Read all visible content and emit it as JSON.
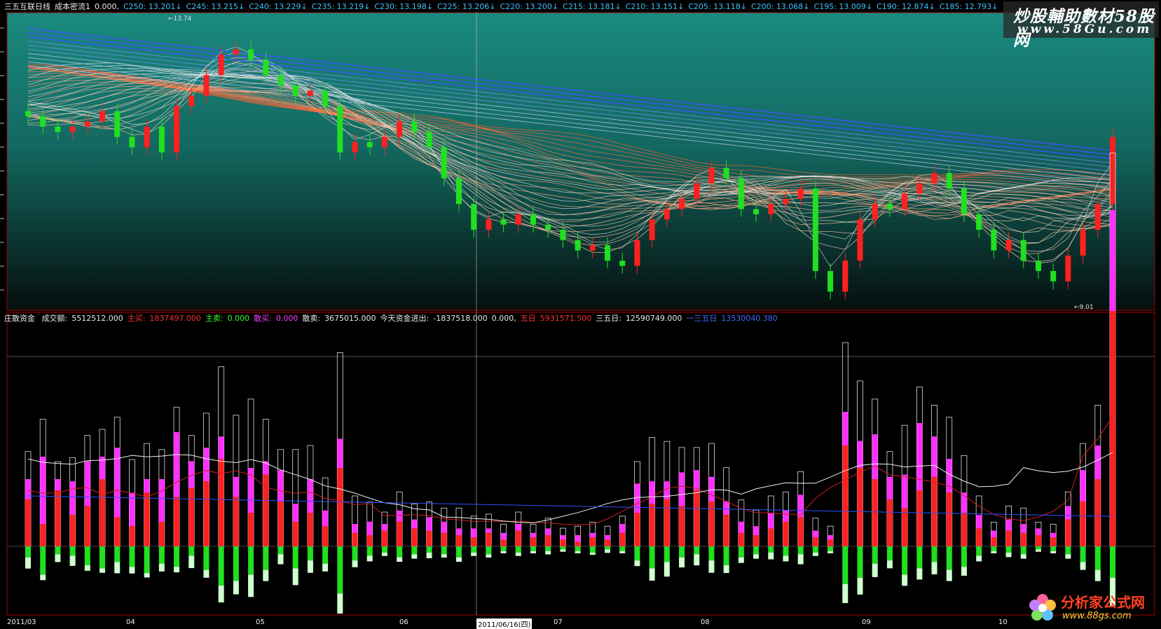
{
  "top_header": {
    "indicator": "三五互联日线",
    "cost_label": "成本密流1",
    "cost_value": "0.000,",
    "c_values": [
      {
        "label": "C250:",
        "value": "13.201"
      },
      {
        "label": "C245:",
        "value": "13.215"
      },
      {
        "label": "C240:",
        "value": "13.229"
      },
      {
        "label": "C235:",
        "value": "13.219"
      },
      {
        "label": "C230:",
        "value": "13.198"
      },
      {
        "label": "C225:",
        "value": "13.206"
      },
      {
        "label": "C220:",
        "value": "13.200"
      },
      {
        "label": "C215:",
        "value": "13.181"
      },
      {
        "label": "C210:",
        "value": "13.151"
      },
      {
        "label": "C205:",
        "value": "13.118"
      },
      {
        "label": "C200:",
        "value": "13.068"
      },
      {
        "label": "C195:",
        "value": "13.009"
      },
      {
        "label": "C190:",
        "value": "12.874"
      },
      {
        "label": "C185:",
        "value": "12.793"
      }
    ]
  },
  "price_marks": {
    "high": "13.74",
    "low": "9.01"
  },
  "bottom_header": {
    "indicator": "庄散资金",
    "volume_label": "成交额:",
    "volume_value": "5512512.000",
    "main_buy_label": "主买:",
    "main_buy_value": "1837497.000",
    "main_sell_label": "主卖:",
    "main_sell_value": "0.000",
    "retail_buy_label": "散买:",
    "retail_buy_value": "0.000",
    "retail_sell_label": "散卖:",
    "retail_sell_value": "3675015.000",
    "today_flow_label": "今天资金进出:",
    "today_flow_value": "-1837518.000",
    "extra_value": "0.000,",
    "five_day_label": "五日",
    "five_day_value": "5931571.500",
    "thirtyfive_label": "三五日:",
    "thirtyfive_value": "12590749.000",
    "blue_label": "一三五日",
    "blue_value": "13530040.380"
  },
  "watermark_top": {
    "title": "炒股輔助數材58股网",
    "url": "www.58Gu.com"
  },
  "watermark_bottom": {
    "title": "分析家公式网",
    "url": "www.88gs.com"
  },
  "bottom_dates": [
    "2011/03",
    "04",
    "05",
    "06",
    "2011/06/16(四)",
    "07",
    "08",
    "09",
    "10"
  ],
  "colors": {
    "up": "#ff2020",
    "down": "#20e020",
    "main_buy": "#ff2020",
    "retail_buy": "#ff30ff",
    "main_sell": "#20e020",
    "retail_sell": "#d0ffd0",
    "bg_top": "#1a7a70",
    "grid": "#800000"
  },
  "chart_data": [
    {
      "type": "candlestick",
      "title": "三五互联日线",
      "ylim": [
        9.01,
        13.74
      ],
      "series": [
        {
          "name": "close",
          "values": [
            12.2,
            12.0,
            11.9,
            12.0,
            12.1,
            12.3,
            11.8,
            11.6,
            12.0,
            11.5,
            12.4,
            12.6,
            13.0,
            13.4,
            13.5,
            13.3,
            13.0,
            12.8,
            12.6,
            12.7,
            12.4,
            11.5,
            11.7,
            11.6,
            11.8,
            12.1,
            11.9,
            11.6,
            11.0,
            10.5,
            10.0,
            10.2,
            10.1,
            10.3,
            10.1,
            10.0,
            9.8,
            9.6,
            9.7,
            9.4,
            9.3,
            9.8,
            10.2,
            10.4,
            10.6,
            10.9,
            11.2,
            11.0,
            10.4,
            10.3,
            10.5,
            10.6,
            10.8,
            9.2,
            8.8,
            9.4,
            10.2,
            10.5,
            10.4,
            10.7,
            10.9,
            11.1,
            10.8,
            10.3,
            10.0,
            9.6,
            9.8,
            9.4,
            9.2,
            9.0,
            9.5,
            10.0,
            10.5,
            11.8
          ]
        }
      ],
      "low_mark": "9.01",
      "high_mark": "13.74"
    },
    {
      "type": "bar",
      "title": "庄散资金",
      "series": [
        {
          "name": "主买",
          "values": [
            42,
            20,
            50,
            28,
            36,
            60,
            26,
            18,
            48,
            22,
            44,
            52,
            58,
            78,
            44,
            30,
            64,
            40,
            22,
            30,
            18,
            70,
            12,
            10,
            14,
            22,
            16,
            14,
            12,
            10,
            8,
            12,
            6,
            14,
            8,
            10,
            6,
            4,
            8,
            6,
            12,
            30,
            38,
            42,
            36,
            50,
            40,
            28,
            12,
            10,
            16,
            22,
            26,
            8,
            6,
            90,
            70,
            60,
            42,
            34,
            50,
            62,
            48,
            30,
            16,
            8,
            14,
            12,
            10,
            8,
            24,
            40,
            60,
            210
          ]
        },
        {
          "name": "散买",
          "values": [
            18,
            60,
            10,
            30,
            40,
            20,
            62,
            30,
            12,
            38,
            58,
            24,
            30,
            20,
            18,
            40,
            12,
            28,
            16,
            30,
            14,
            26,
            8,
            12,
            6,
            10,
            8,
            12,
            10,
            6,
            8,
            4,
            6,
            6,
            4,
            6,
            4,
            6,
            4,
            4,
            8,
            26,
            20,
            16,
            30,
            18,
            22,
            12,
            10,
            8,
            14,
            10,
            20,
            6,
            4,
            30,
            24,
            40,
            20,
            30,
            60,
            36,
            30,
            18,
            12,
            6,
            10,
            8,
            6,
            4,
            12,
            28,
            30,
            90
          ]
        },
        {
          "name": "主卖",
          "values": [
            14,
            36,
            10,
            12,
            24,
            28,
            20,
            26,
            34,
            22,
            26,
            12,
            30,
            50,
            44,
            36,
            30,
            10,
            28,
            18,
            22,
            60,
            18,
            12,
            8,
            14,
            10,
            8,
            10,
            14,
            8,
            10,
            6,
            8,
            6,
            6,
            4,
            6,
            8,
            4,
            6,
            18,
            28,
            20,
            14,
            10,
            18,
            24,
            14,
            10,
            8,
            12,
            10,
            8,
            6,
            48,
            40,
            22,
            18,
            36,
            28,
            20,
            30,
            26,
            12,
            6,
            8,
            10,
            4,
            6,
            10,
            20,
            30,
            40
          ]
        },
        {
          "name": "散卖",
          "values": [
            20,
            10,
            14,
            18,
            10,
            8,
            20,
            12,
            8,
            14,
            10,
            22,
            14,
            30,
            24,
            40,
            20,
            18,
            30,
            22,
            14,
            36,
            12,
            10,
            6,
            8,
            8,
            10,
            6,
            8,
            6,
            6,
            4,
            6,
            4,
            6,
            4,
            4,
            4,
            6,
            4,
            10,
            22,
            26,
            18,
            20,
            22,
            14,
            10,
            8,
            12,
            10,
            18,
            6,
            4,
            34,
            30,
            24,
            14,
            20,
            20,
            22,
            20,
            16,
            10,
            4,
            8,
            8,
            4,
            4,
            8,
            14,
            20,
            50
          ]
        }
      ]
    }
  ]
}
